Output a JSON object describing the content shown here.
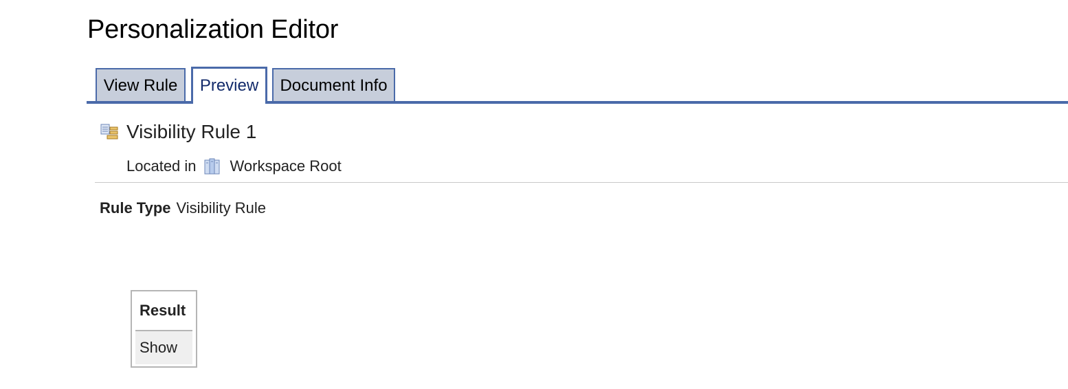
{
  "header": {
    "title": "Personalization Editor"
  },
  "tabs": [
    {
      "label": "View Rule",
      "active": false
    },
    {
      "label": "Preview",
      "active": true
    },
    {
      "label": "Document Info",
      "active": false
    }
  ],
  "rule": {
    "icon": "rule-icon",
    "name": "Visibility Rule 1",
    "location_label": "Located in",
    "location_icon": "workspace-icon",
    "location_value": "Workspace Root",
    "type_label": "Rule Type",
    "type_value": "Visibility Rule"
  },
  "result_table": {
    "header": "Result",
    "rows": [
      "Show"
    ]
  },
  "colors": {
    "tab_border": "#4a6aa9",
    "tab_inactive_bg": "#c7cedb",
    "tab_active_text": "#122a6a"
  }
}
